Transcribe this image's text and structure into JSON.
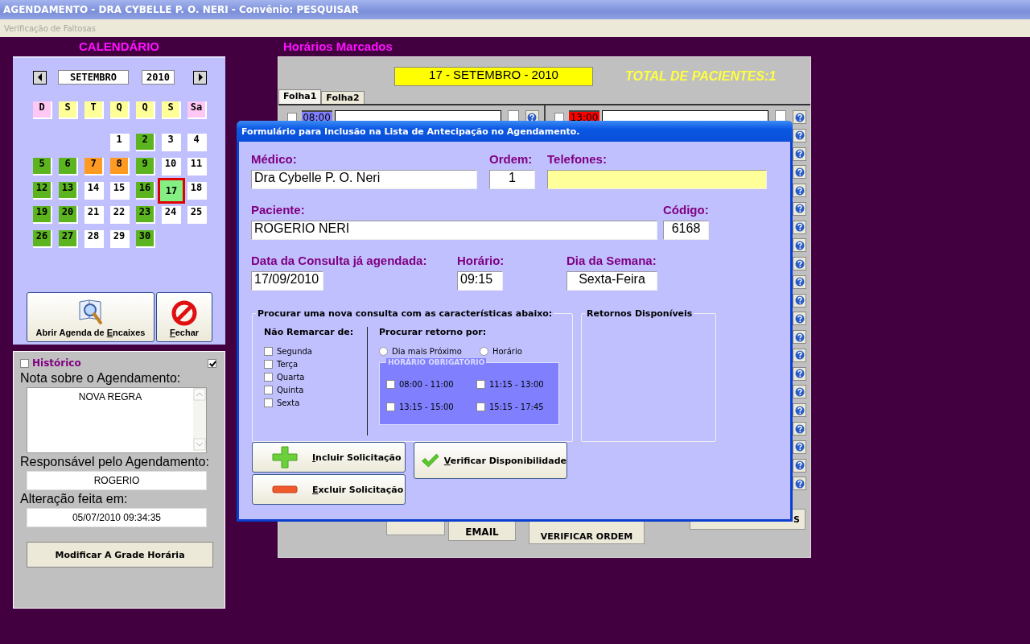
{
  "window": {
    "title": "AGENDAMENTO - DRA CYBELLE P. O. NERI - Convênio: PESQUISAR"
  },
  "menu": [
    {
      "label": "Verificação de Faltosas",
      "disabled": true
    }
  ],
  "calendar": {
    "title": "CALENDÁRIO",
    "month": "SETEMBRO",
    "year": "2010",
    "weekdays": [
      {
        "label": "D",
        "color": "#ffc8f4"
      },
      {
        "label": "S",
        "color": "#ffff99"
      },
      {
        "label": "T",
        "color": "#ffff99"
      },
      {
        "label": "Q",
        "color": "#ffff99"
      },
      {
        "label": "Q",
        "color": "#ffff99"
      },
      {
        "label": "S",
        "color": "#ffff99"
      },
      {
        "label": "Sa",
        "color": "#ffc8f4"
      }
    ],
    "days": [
      {
        "kind": "blank"
      },
      {
        "kind": "blank"
      },
      {
        "kind": "blank"
      },
      {
        "kind": "day",
        "label": "1",
        "color": "#ffffff",
        "selected": false
      },
      {
        "kind": "day",
        "label": "2",
        "color": "#5cb41e",
        "selected": false
      },
      {
        "kind": "day",
        "label": "3",
        "color": "#ffffff",
        "selected": false
      },
      {
        "kind": "day",
        "label": "4",
        "color": "#ffffff",
        "selected": false
      },
      {
        "kind": "day",
        "label": "5",
        "color": "#5cb41e",
        "selected": false
      },
      {
        "kind": "day",
        "label": "6",
        "color": "#5cb41e",
        "selected": false
      },
      {
        "kind": "day",
        "label": "7",
        "color": "#ff9a22",
        "selected": false
      },
      {
        "kind": "day",
        "label": "8",
        "color": "#ff9a22",
        "selected": false
      },
      {
        "kind": "day",
        "label": "9",
        "color": "#5cb41e",
        "selected": false
      },
      {
        "kind": "day",
        "label": "10",
        "color": "#ffffff",
        "selected": false
      },
      {
        "kind": "day",
        "label": "11",
        "color": "#ffffff",
        "selected": false
      },
      {
        "kind": "day",
        "label": "12",
        "color": "#5cb41e",
        "selected": false
      },
      {
        "kind": "day",
        "label": "13",
        "color": "#5cb41e",
        "selected": false
      },
      {
        "kind": "day",
        "label": "14",
        "color": "#ffffff",
        "selected": false
      },
      {
        "kind": "day",
        "label": "15",
        "color": "#ffffff",
        "selected": false
      },
      {
        "kind": "day",
        "label": "16",
        "color": "#5cb41e",
        "selected": false
      },
      {
        "kind": "day",
        "label": "17",
        "color": "#84f084",
        "selected": true
      },
      {
        "kind": "day",
        "label": "18",
        "color": "#ffffff",
        "selected": false
      },
      {
        "kind": "day",
        "label": "19",
        "color": "#5cb41e",
        "selected": false
      },
      {
        "kind": "day",
        "label": "20",
        "color": "#5cb41e",
        "selected": false
      },
      {
        "kind": "day",
        "label": "21",
        "color": "#ffffff",
        "selected": false
      },
      {
        "kind": "day",
        "label": "22",
        "color": "#ffffff",
        "selected": false
      },
      {
        "kind": "day",
        "label": "23",
        "color": "#5cb41e",
        "selected": false
      },
      {
        "kind": "day",
        "label": "24",
        "color": "#ffffff",
        "selected": false
      },
      {
        "kind": "day",
        "label": "25",
        "color": "#ffffff",
        "selected": false
      },
      {
        "kind": "day",
        "label": "26",
        "color": "#5cb41e",
        "selected": false
      },
      {
        "kind": "day",
        "label": "27",
        "color": "#5cb41e",
        "selected": false
      },
      {
        "kind": "day",
        "label": "28",
        "color": "#ffffff",
        "selected": false
      },
      {
        "kind": "day",
        "label": "29",
        "color": "#ffffff",
        "selected": false
      },
      {
        "kind": "day",
        "label": "30",
        "color": "#5cb41e",
        "selected": false
      }
    ],
    "buttons": [
      {
        "kind": "search",
        "pre": "Abrir Agenda de ",
        "key": "E",
        "post": "ncaixes"
      },
      {
        "kind": "close",
        "key": "F",
        "post": "echar"
      }
    ]
  },
  "notes": {
    "history": {
      "label": "Histórico",
      "checked": false
    },
    "toggle": {
      "checked": true
    },
    "note_label": "Nota sobre o Agendamento:",
    "note": "NOVA REGRA",
    "responsible_label": "Responsável pelo Agendamento:",
    "responsible": "ROGERIO",
    "changed_label": "Alteração feita em:",
    "changed": "05/07/2010 09:34:35",
    "button": "Modificar A Grade Horária"
  },
  "schedule": {
    "title": "Horários Marcados",
    "date": "17 - SETEMBRO - 2010",
    "total": "TOTAL DE PACIENTES:1",
    "tabs": [
      {
        "label": "Folha1",
        "selected": true
      },
      {
        "label": "Folha2",
        "selected": false
      }
    ],
    "columns": [
      {
        "rows": [
          {
            "kind": "full",
            "time": "08:00",
            "color": "#8080ff",
            "checked": false,
            "marked": false
          }
        ]
      },
      {
        "rows": [
          {
            "kind": "full",
            "time": "13:00",
            "color": "#ff0000",
            "checked": false,
            "marked": false
          },
          {
            "kind": "help"
          },
          {
            "kind": "help"
          },
          {
            "kind": "help"
          },
          {
            "kind": "help"
          },
          {
            "kind": "help"
          },
          {
            "kind": "help"
          },
          {
            "kind": "help"
          },
          {
            "kind": "help"
          },
          {
            "kind": "help"
          },
          {
            "kind": "help"
          },
          {
            "kind": "help"
          },
          {
            "kind": "help"
          },
          {
            "kind": "help"
          },
          {
            "kind": "help"
          },
          {
            "kind": "help"
          },
          {
            "kind": "help"
          },
          {
            "kind": "help"
          },
          {
            "kind": "help"
          },
          {
            "kind": "help"
          },
          {
            "kind": "help"
          }
        ]
      }
    ],
    "footer_buttons": [
      {
        "kind": "plain"
      },
      {
        "kind": "email",
        "label": "EMAIL"
      },
      {
        "kind": "order",
        "label": "VERIFICAR ORDEM"
      },
      {
        "kind": "tail",
        "label": "S"
      }
    ]
  },
  "dialog": {
    "title": "Formulário para Inclusão na Lista de Antecipação no Agendamento.",
    "medico_label": "Médico:",
    "medico": "Dra Cybelle P. O. Neri",
    "ordem_label": "Ordem:",
    "ordem": "1",
    "telefones_label": "Telefones:",
    "paciente_label": "Paciente:",
    "paciente": "ROGERIO NERI",
    "codigo_label": "Código:",
    "codigo": "6168",
    "data_label": "Data da Consulta já agendada:",
    "data": "17/09/2010",
    "horario_label": "Horário:",
    "horario": "09:15",
    "dia_label": "Dia da Semana:",
    "dia": "Sexta-Feira",
    "search_group": "Procurar uma nova consulta com as características abaixo:",
    "exclude_label": "Não Remarcar de:",
    "exclude_days": [
      {
        "label": "Segunda",
        "checked": false
      },
      {
        "label": "Terça",
        "checked": false
      },
      {
        "label": "Quarta",
        "checked": false
      },
      {
        "label": "Quinta",
        "checked": false
      },
      {
        "label": "Sexta",
        "checked": false
      }
    ],
    "return_label": "Procurar retorno por:",
    "return_options": [
      {
        "label": "Dia mais Próximo",
        "selected": false
      },
      {
        "label": "Horário",
        "selected": false
      }
    ],
    "mandatory_title": "HORÁRIO OBRIGATÓRIO",
    "mandatory_slots": [
      {
        "label": "08:00 - 11:00",
        "checked": false
      },
      {
        "label": "11:15 - 13:00",
        "checked": false
      },
      {
        "label": "13:15 - 15:00",
        "checked": false
      },
      {
        "label": "15:15 - 17:45",
        "checked": false
      }
    ],
    "returns_group": "Retornos Disponíveis",
    "buttons": [
      {
        "kind": "add",
        "key": "I",
        "post": "ncluir Solicitação"
      },
      {
        "kind": "check",
        "key": "V",
        "post": "erificar Disponibilidade"
      },
      {
        "kind": "remove",
        "key": "E",
        "post": "xcluir Solicitação"
      }
    ]
  }
}
